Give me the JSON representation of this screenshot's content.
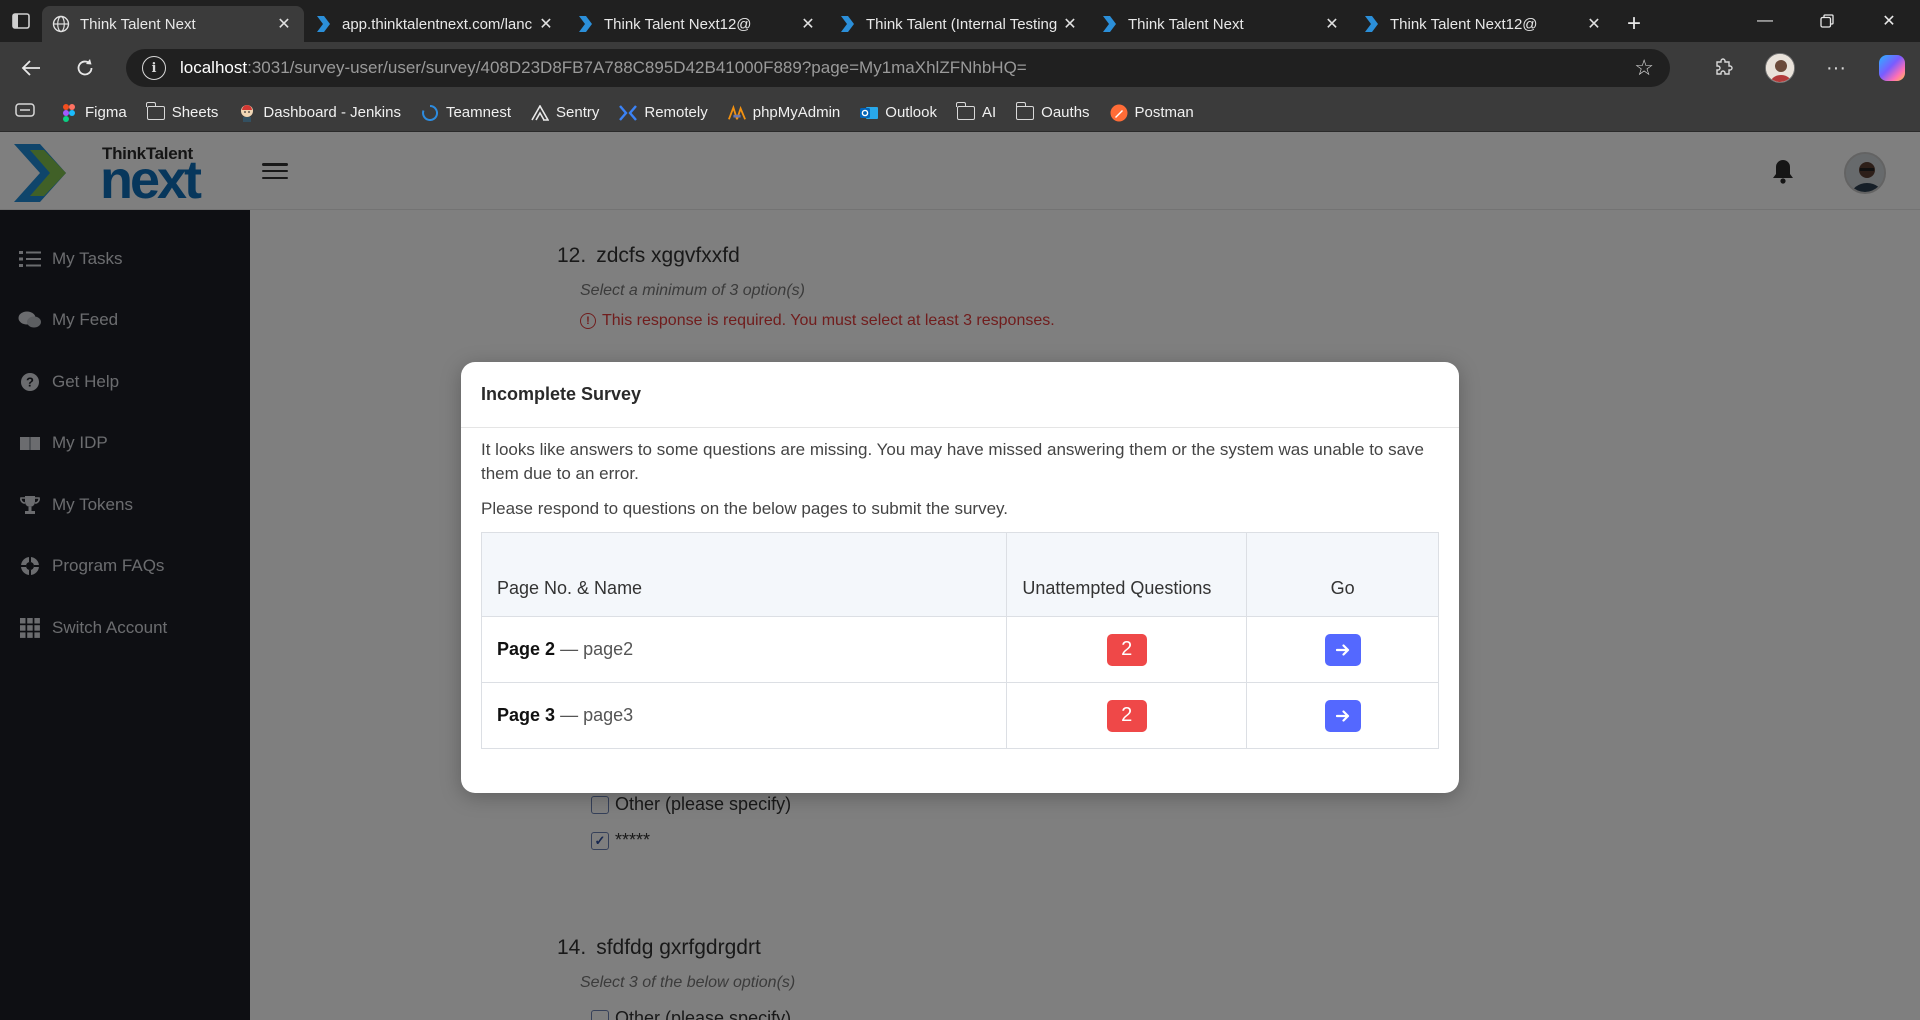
{
  "browser": {
    "tabs": [
      {
        "title": "Think Talent Next",
        "active": true,
        "icon": "globe-icon"
      },
      {
        "title": "app.thinktalentnext.com/lanc",
        "active": false,
        "icon": "ttn-chevron-icon"
      },
      {
        "title": "Think Talent Next12@",
        "active": false,
        "icon": "ttn-chevron-icon"
      },
      {
        "title": "Think Talent (Internal Testing",
        "active": false,
        "icon": "ttn-chevron-icon"
      },
      {
        "title": "Think Talent Next",
        "active": false,
        "icon": "ttn-chevron-icon"
      },
      {
        "title": "Think Talent Next12@",
        "active": false,
        "icon": "ttn-chevron-icon"
      }
    ],
    "address": {
      "host": "localhost",
      "rest": ":3031/survey-user/user/survey/408D23D8FB7A788C895D42B41000F889?page=My1maXhlZFNhbHQ="
    },
    "bookmarks": [
      {
        "label": "Figma",
        "icon": "figma-icon"
      },
      {
        "label": "Sheets",
        "icon": "folder-icon"
      },
      {
        "label": "Dashboard - Jenkins",
        "icon": "jenkins-icon"
      },
      {
        "label": "Teamnest",
        "icon": "teamnest-icon"
      },
      {
        "label": "Sentry",
        "icon": "sentry-icon"
      },
      {
        "label": "Remotely",
        "icon": "remotely-icon"
      },
      {
        "label": "phpMyAdmin",
        "icon": "phpmyadmin-icon"
      },
      {
        "label": "Outlook",
        "icon": "outlook-icon"
      },
      {
        "label": "AI",
        "icon": "folder-icon"
      },
      {
        "label": "Oauths",
        "icon": "folder-icon"
      },
      {
        "label": "Postman",
        "icon": "postman-icon"
      }
    ]
  },
  "app": {
    "logo": {
      "top": "ThinkTalent",
      "bottom": "next"
    },
    "sidebar": [
      {
        "label": "My Tasks",
        "icon": "tasks-icon"
      },
      {
        "label": "My Feed",
        "icon": "feed-icon"
      },
      {
        "label": "Get Help",
        "icon": "help-icon"
      },
      {
        "label": "My IDP",
        "icon": "idp-icon"
      },
      {
        "label": "My Tokens",
        "icon": "trophy-icon"
      },
      {
        "label": "Program FAQs",
        "icon": "faq-icon"
      },
      {
        "label": "Switch Account",
        "icon": "grid-icon"
      }
    ]
  },
  "survey": {
    "q12": {
      "number": "12.",
      "title": "zdcfs xggvfxxfd",
      "help": "Select a minimum of 3 option(s)",
      "error": "This response is required. You must select at least 3 responses."
    },
    "q13_options": [
      {
        "label": "Other (please specify)",
        "checked": false
      },
      {
        "label": "*****",
        "checked": true
      }
    ],
    "q14": {
      "number": "14.",
      "title": "sfdfdg gxrfgdrgdrt",
      "help": "Select 3 of the below option(s)",
      "option_partial": "Other (please specify)"
    }
  },
  "modal": {
    "title": "Incomplete Survey",
    "text1": "It looks like answers to some questions are missing. You may have missed answering them or the system was unable to save them due to an error.",
    "text2": "Please respond to questions on the below pages to submit the survey.",
    "columns": [
      "Page No. & Name",
      "Unattempted Questions",
      "Go"
    ],
    "rows": [
      {
        "page": "Page 2",
        "separator": "—",
        "name": "page2",
        "count": "2"
      },
      {
        "page": "Page 3",
        "separator": "—",
        "name": "page3",
        "count": "2"
      }
    ]
  },
  "colors": {
    "error": "#e03a3a",
    "badge": "#ef4848",
    "go_button": "#5468ff",
    "brand_blue": "#0f6fb8",
    "sidebar_bg": "#1c1f26"
  }
}
